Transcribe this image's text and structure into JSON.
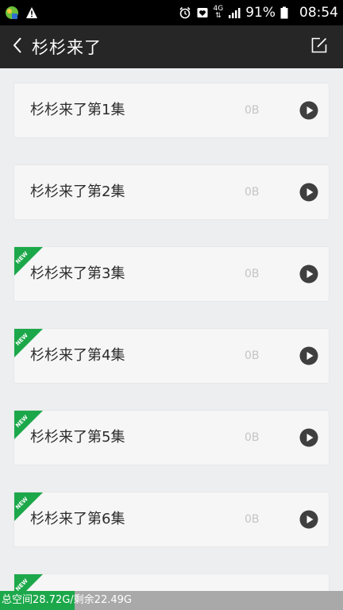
{
  "status_bar": {
    "network": "4G",
    "battery": "91%",
    "time": "08:54",
    "icons": [
      "app-icon",
      "warning-icon",
      "alarm-icon",
      "heart-icon",
      "signal-icon",
      "battery-icon"
    ]
  },
  "header": {
    "title": "杉杉来了",
    "back_icon": "chevron-left-icon",
    "edit_icon": "edit-icon"
  },
  "colors": {
    "accent": "#1ca84a",
    "header_bg": "#262626",
    "list_bg": "#eceeef",
    "storage_bg": "#a9a9a9"
  },
  "episodes": [
    {
      "title": "杉杉来了第1集",
      "size": "0B",
      "is_new": false
    },
    {
      "title": "杉杉来了第2集",
      "size": "0B",
      "is_new": false
    },
    {
      "title": "杉杉来了第3集",
      "size": "0B",
      "is_new": true
    },
    {
      "title": "杉杉来了第4集",
      "size": "0B",
      "is_new": true
    },
    {
      "title": "杉杉来了第5集",
      "size": "0B",
      "is_new": true
    },
    {
      "title": "杉杉来了第6集",
      "size": "0B",
      "is_new": true
    },
    {
      "title": "",
      "size": "",
      "is_new": true
    }
  ],
  "badge": {
    "label": "NEW"
  },
  "storage": {
    "text": "总空间28.72G/剩余22.49G",
    "used_fraction": 0.217
  }
}
